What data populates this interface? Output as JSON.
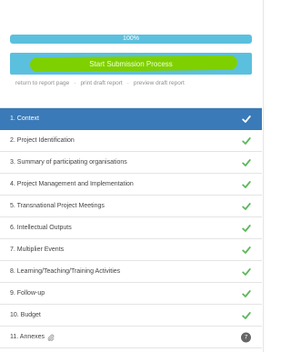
{
  "progress": {
    "label": "100%",
    "percent": 100
  },
  "submit": {
    "label": "Start Submission Process"
  },
  "report_links": {
    "return": "return to report page",
    "print": "print draft report",
    "preview": "preview draft report",
    "separator": "·"
  },
  "colors": {
    "accent": "#5bc0de",
    "active_row": "#3a7ab8",
    "check": "#5cb85c",
    "highlight": "#7fd000"
  },
  "steps": [
    {
      "label": "1. Context",
      "status_icon": "check-icon"
    },
    {
      "label": "2. Project Identification",
      "status_icon": "check-icon"
    },
    {
      "label": "3. Summary of participating organisations",
      "status_icon": "check-icon"
    },
    {
      "label": "4. Project Management and Implementation",
      "status_icon": "check-icon"
    },
    {
      "label": "5. Transnational Project Meetings",
      "status_icon": "check-icon"
    },
    {
      "label": "6. Intellectual Outputs",
      "status_icon": "check-icon"
    },
    {
      "label": "7. Multiplier Events",
      "status_icon": "check-icon"
    },
    {
      "label": "8. Learning/Teaching/Training Activities",
      "status_icon": "check-icon"
    },
    {
      "label": "9. Follow-up",
      "status_icon": "check-icon"
    },
    {
      "label": "10. Budget",
      "status_icon": "check-icon"
    },
    {
      "label": "11. Annexes",
      "status_icon": "count-badge",
      "badge": "7",
      "label_icon": "paperclip-icon"
    }
  ]
}
